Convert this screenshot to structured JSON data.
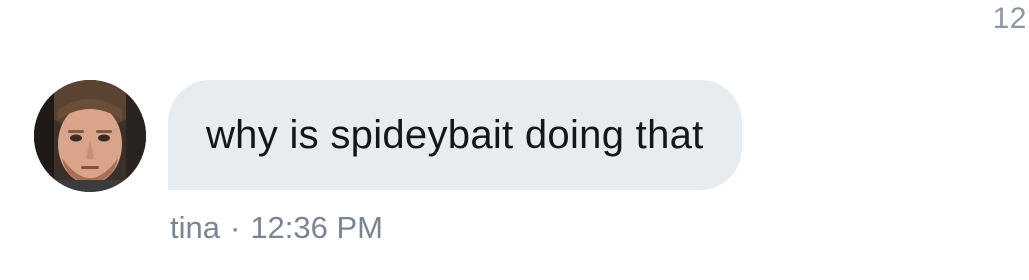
{
  "header": {
    "corner_number": "12"
  },
  "message": {
    "text": "why is spideybait doing that",
    "sender": "tina",
    "separator": "·",
    "time": "12:36 PM",
    "bubble_color": "#e6ecf0"
  },
  "icons": {
    "avatar": "user-photo-avatar"
  }
}
